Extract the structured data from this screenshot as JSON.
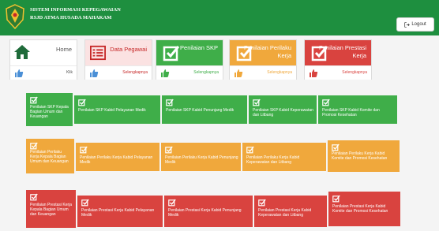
{
  "header": {
    "title_line1": "SISTEM INFORMASI KEPEGAWAIAN",
    "title_line2": "RSJD ATMA HUSADA MAHAKAM",
    "logout_label": "Logout"
  },
  "cards": [
    {
      "label": "Home",
      "more": "Klik"
    },
    {
      "label": "Data Pegawai",
      "more": "Selengkapnya"
    },
    {
      "label": "Penilaian SKP",
      "more": "Selengkapnya"
    },
    {
      "label": "Penilaian Perilaku Kerja",
      "more": "Selengkapnya"
    },
    {
      "label": "Penilaian Prestasi Kerja",
      "more": "Selengkapnya"
    }
  ],
  "rows": {
    "skp": [
      "Penilaian SKP Kepala Bagian Umum dan Keuangan",
      "Penilaian SKP Kabid Pelayanan Medik",
      "Penilaian SKP Kabid Penunjang Medik",
      "Penilaian SKP Kabid Keperawatan dan Litbang",
      "Penilaian SKP Kabid Komite dan Promosi Kesehatan"
    ],
    "perilaku": [
      "Penilaian Perilaku Kerja Kepala Bagian Umum dan Keuangan",
      "Penilaian Perilaku Kerja Kabid Pelayanan Medik",
      "Penilaian Perilaku Kerja Kabid Penunjang Medik",
      "Penilaian Perilaku Kerja Kabid Keperawatan dan Litbang",
      "Penilaian Perilaku Kerja Kabid Komite dan Promosi Kesehatan"
    ],
    "prestasi": [
      "Penilaian Prestasi Kerja Kepala Bagian Umum dan Keuangan",
      "Penilaian Prestasi Kerja Kabid Pelayanan Medik",
      "Penilaian Prestasi Kerja Kabid Penunjang Medik",
      "Penilaian Prestasi Kerja Kabid Keperawatan dan Litbang",
      "Penilaian Prestasi Kerja Kabid Komite dan Promosi Kesehatan"
    ]
  },
  "colors": {
    "header": "#1e8f3f",
    "green": "#3fae49",
    "orange": "#f0a83c",
    "red": "#d9433f"
  }
}
